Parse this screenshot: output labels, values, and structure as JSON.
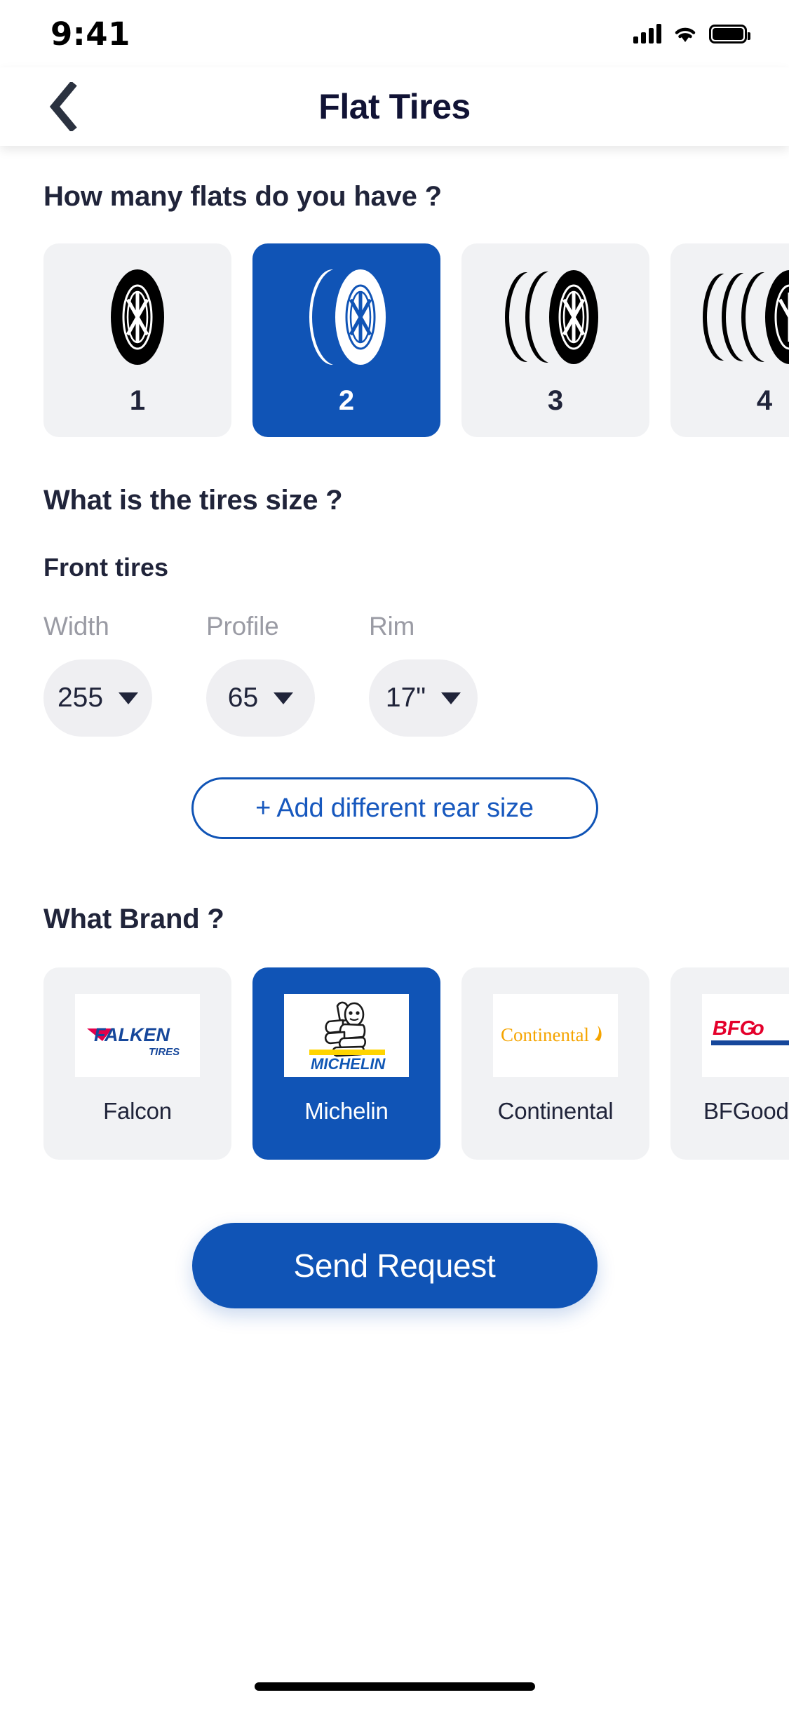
{
  "status_bar": {
    "time": "9:41",
    "signal_icon": "cellular-bars-icon",
    "wifi_icon": "wifi-icon",
    "battery_icon": "battery-full-icon"
  },
  "header": {
    "back_icon": "chevron-left-icon",
    "title": "Flat Tires"
  },
  "accent_color": "#1054B6",
  "title_color": "#111335",
  "card_bg": "#F1F2F4",
  "muted_color": "#9A9BA4",
  "flats_section": {
    "question": "How many flats do you have ?",
    "selected_index": 1,
    "options": [
      {
        "label": "1",
        "icon": "one-tire-icon",
        "tires": 1
      },
      {
        "label": "2",
        "icon": "two-tires-icon",
        "tires": 2
      },
      {
        "label": "3",
        "icon": "three-tires-icon",
        "tires": 3
      },
      {
        "label": "4",
        "icon": "four-tires-icon",
        "tires": 4
      }
    ]
  },
  "size_section": {
    "question": "What is the tires size ?",
    "front_label": "Front tires",
    "fields": [
      {
        "caption": "Width",
        "value": "255",
        "icon": "chevron-down-icon"
      },
      {
        "caption": "Profile",
        "value": "65",
        "icon": "chevron-down-icon"
      },
      {
        "caption": "Rim",
        "value": "17\"",
        "icon": "chevron-down-icon"
      }
    ],
    "add_rear_label": "+ Add different rear size"
  },
  "brand_section": {
    "question": "What Brand ?",
    "selected_index": 1,
    "brands": [
      {
        "name": "Falcon",
        "logo": "falken-tires-logo",
        "logo_text": "FALKEN",
        "logo_sub": "TIRES"
      },
      {
        "name": "Michelin",
        "logo": "michelin-logo",
        "logo_text": "MICHELIN",
        "logo_sub": ""
      },
      {
        "name": "Continental",
        "logo": "continental-logo",
        "logo_text": "Continental",
        "logo_sub": ""
      },
      {
        "name": "BFGoodrich",
        "logo": "bfgoodrich-logo",
        "logo_text": "BFG",
        "logo_sub": ""
      }
    ]
  },
  "submit": {
    "label": "Send Request"
  },
  "home_indicator": "home-indicator"
}
